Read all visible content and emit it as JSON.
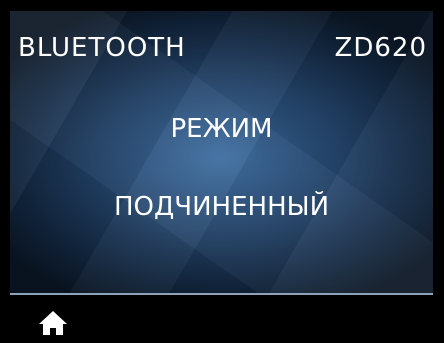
{
  "header": {
    "title": "BLUETOOTH",
    "model": "ZD620"
  },
  "setting": {
    "label": "РЕЖИМ",
    "value": "ПОДЧИНЕННЫЙ"
  },
  "footer": {
    "home_icon": "home-icon"
  },
  "colors": {
    "text": "#ffffff",
    "background_center": "#3c6ca0",
    "background_edge": "#0a1523",
    "divider": "#8fa3b8"
  }
}
